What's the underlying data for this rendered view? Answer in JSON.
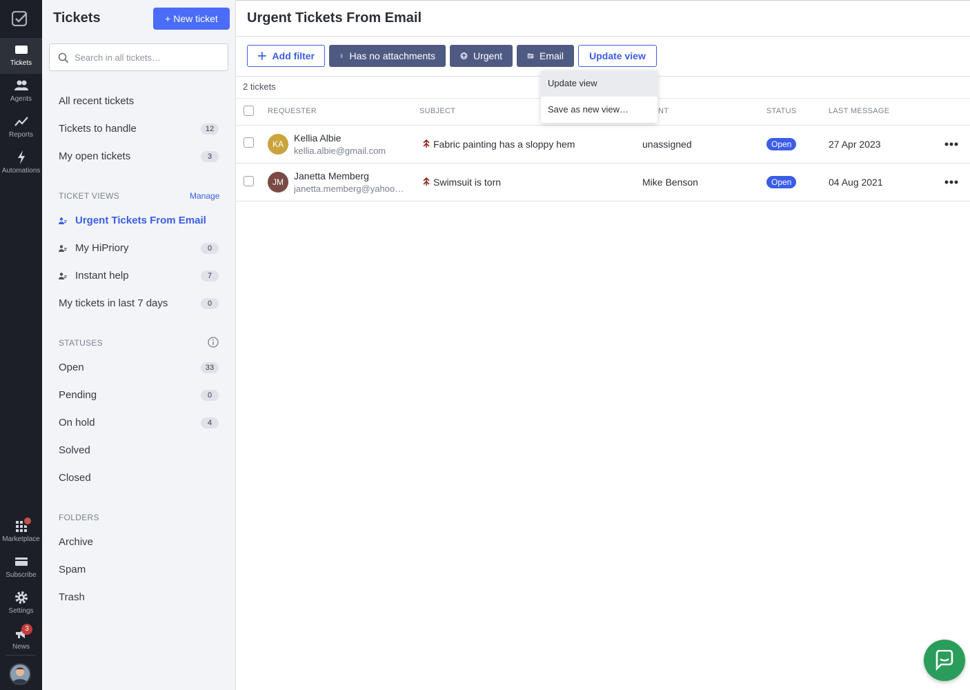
{
  "rail": {
    "items": [
      {
        "label": "Tickets",
        "icon": "ticket-icon"
      },
      {
        "label": "Agents",
        "icon": "agents-icon"
      },
      {
        "label": "Reports",
        "icon": "reports-icon"
      },
      {
        "label": "Automations",
        "icon": "automations-icon"
      },
      {
        "label": "Marketplace",
        "icon": "marketplace-icon"
      },
      {
        "label": "Subscribe",
        "icon": "subscribe-icon"
      },
      {
        "label": "Settings",
        "icon": "settings-icon"
      },
      {
        "label": "News",
        "icon": "news-icon"
      }
    ],
    "news_badge": "3"
  },
  "sidebar": {
    "title": "Tickets",
    "new_ticket_label": "+ New ticket",
    "search_placeholder": "Search in all tickets…",
    "quick_items": [
      {
        "label": "All recent tickets",
        "count": ""
      },
      {
        "label": "Tickets to handle",
        "count": "12"
      },
      {
        "label": "My open tickets",
        "count": "3"
      }
    ],
    "views_heading": "TICKET VIEWS",
    "manage_label": "Manage",
    "views": [
      {
        "label": "Urgent Tickets From Email",
        "count": "",
        "active": true
      },
      {
        "label": "My HiPriory",
        "count": "0"
      },
      {
        "label": "Instant help",
        "count": "7"
      },
      {
        "label": "My tickets in last 7 days",
        "count": "0"
      }
    ],
    "statuses_heading": "STATUSES",
    "statuses": [
      {
        "label": "Open",
        "count": "33"
      },
      {
        "label": "Pending",
        "count": "0"
      },
      {
        "label": "On hold",
        "count": "4"
      },
      {
        "label": "Solved",
        "count": ""
      },
      {
        "label": "Closed",
        "count": ""
      }
    ],
    "folders_heading": "FOLDERS",
    "folders": [
      {
        "label": "Archive"
      },
      {
        "label": "Spam"
      },
      {
        "label": "Trash"
      }
    ]
  },
  "main": {
    "title": "Urgent Tickets From Email",
    "filters": {
      "add_filter": "Add filter",
      "attachments": "Has no attachments",
      "urgent": "Urgent",
      "email": "Email",
      "update_view": "Update view"
    },
    "ticket_count": "2 tickets",
    "columns": {
      "requester": "REQUESTER",
      "subject": "SUBJECT",
      "agent": "NT",
      "status": "STATUS",
      "last_message": "LAST MESSAGE"
    },
    "rows": [
      {
        "initials": "KA",
        "name": "Kellia Albie",
        "email": "kellia.albie@gmail.com",
        "subject": "Fabric painting has a sloppy hem",
        "agent": "unassigned",
        "status": "Open",
        "last_message": "27 Apr 2023",
        "avatar_color": "#c9a43d"
      },
      {
        "initials": "JM",
        "name": "Janetta Memberg",
        "email": "janetta.memberg@yahoo.com",
        "subject": "Swimsuit is torn",
        "agent": "Mike Benson",
        "status": "Open",
        "last_message": "04 Aug 2021",
        "avatar_color": "#7a4a44"
      }
    ],
    "dropdown": {
      "update_view": "Update view",
      "save_as_new": "Save as new view…"
    }
  },
  "colors": {
    "accent": "#4a6cf7",
    "filter_chip": "#4f5a82",
    "rail": "#1c1f25",
    "chat": "#2a9d5b"
  }
}
